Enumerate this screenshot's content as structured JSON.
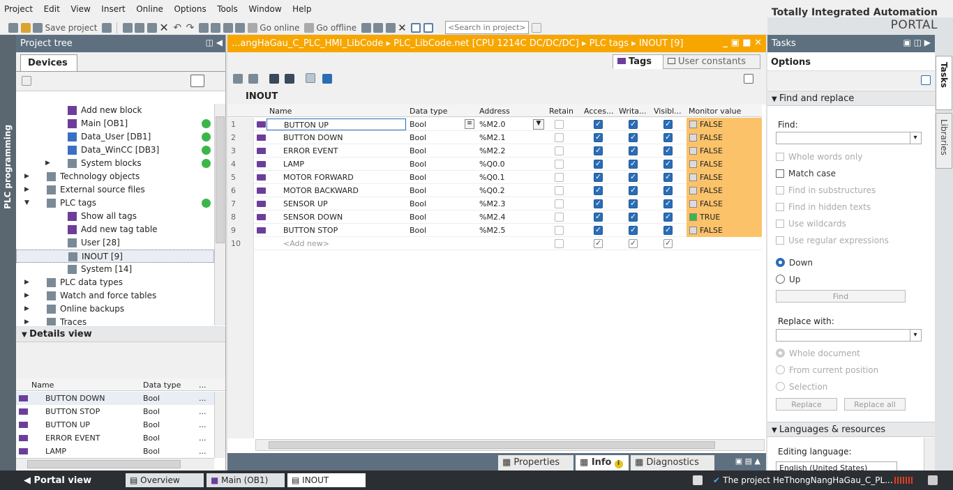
{
  "menu": [
    "Project",
    "Edit",
    "View",
    "Insert",
    "Online",
    "Options",
    "Tools",
    "Window",
    "Help"
  ],
  "toolbar": {
    "save": "Save project",
    "go_online": "Go online",
    "go_offline": "Go offline",
    "search_placeholder": "<Search in project>"
  },
  "brand": {
    "line1": "Totally Integrated Automation",
    "line2": "PORTAL"
  },
  "side_tab": "PLC programming",
  "project_tree": {
    "title": "Project tree",
    "devices_tab": "Devices",
    "items": [
      {
        "label": "Add new block",
        "status": false
      },
      {
        "label": "Main [OB1]",
        "status": true
      },
      {
        "label": "Data_User [DB1]",
        "status": true
      },
      {
        "label": "Data_WinCC [DB3]",
        "status": true
      },
      {
        "label": "System blocks",
        "status": true
      },
      {
        "label": "Technology objects",
        "status": false
      },
      {
        "label": "External source files",
        "status": false
      },
      {
        "label": "PLC tags",
        "status": true
      },
      {
        "label": "Show all tags",
        "status": false
      },
      {
        "label": "Add new tag table",
        "status": false
      },
      {
        "label": "User [28]",
        "status": false
      },
      {
        "label": "INOUT [9]",
        "status": false
      },
      {
        "label": "System [14]",
        "status": false
      },
      {
        "label": "PLC data types",
        "status": false
      },
      {
        "label": "Watch and force tables",
        "status": false
      },
      {
        "label": "Online backups",
        "status": false
      },
      {
        "label": "Traces",
        "status": false
      }
    ]
  },
  "details": {
    "title": "Details view",
    "col_name": "Name",
    "col_type": "Data type",
    "col_more": "...",
    "rows": [
      {
        "name": "BUTTON DOWN",
        "type": "Bool"
      },
      {
        "name": "BUTTON STOP",
        "type": "Bool"
      },
      {
        "name": "BUTTON UP",
        "type": "Bool"
      },
      {
        "name": "ERROR EVENT",
        "type": "Bool"
      },
      {
        "name": "LAMP",
        "type": "Bool"
      }
    ]
  },
  "editor": {
    "breadcrumb": [
      "...angHaGau_C_PLC_HMI_LibCode",
      "PLC_LibCode.net [CPU 1214C DC/DC/DC]",
      "PLC tags",
      "INOUT [9]"
    ],
    "tab_tags": "Tags",
    "tab_constants": "User constants",
    "table_title": "INOUT",
    "columns": [
      "Name",
      "Data type",
      "Address",
      "Retain",
      "Acces...",
      "Writa...",
      "Visibl...",
      "Monitor value"
    ],
    "rows": [
      {
        "n": "1",
        "name": "BUTTON UP",
        "type": "Bool",
        "addr": "%M2.0",
        "mon": "FALSE"
      },
      {
        "n": "2",
        "name": "BUTTON DOWN",
        "type": "Bool",
        "addr": "%M2.1",
        "mon": "FALSE"
      },
      {
        "n": "3",
        "name": "ERROR EVENT",
        "type": "Bool",
        "addr": "%M2.2",
        "mon": "FALSE"
      },
      {
        "n": "4",
        "name": "LAMP",
        "type": "Bool",
        "addr": "%Q0.0",
        "mon": "FALSE"
      },
      {
        "n": "5",
        "name": "MOTOR FORWARD",
        "type": "Bool",
        "addr": "%Q0.1",
        "mon": "FALSE"
      },
      {
        "n": "6",
        "name": "MOTOR BACKWARD",
        "type": "Bool",
        "addr": "%Q0.2",
        "mon": "FALSE"
      },
      {
        "n": "7",
        "name": "SENSOR UP",
        "type": "Bool",
        "addr": "%M2.3",
        "mon": "FALSE"
      },
      {
        "n": "8",
        "name": "SENSOR DOWN",
        "type": "Bool",
        "addr": "%M2.4",
        "mon": "TRUE"
      },
      {
        "n": "9",
        "name": "BUTTON STOP",
        "type": "Bool",
        "addr": "%M2.5",
        "mon": "FALSE"
      }
    ],
    "add_row": {
      "n": "10",
      "name": "<Add new>"
    }
  },
  "info_tabs": [
    "Properties",
    "Info",
    "Diagnostics"
  ],
  "tasks": {
    "title": "Tasks",
    "options": "Options",
    "find_replace": "Find and replace",
    "find_label": "Find:",
    "whole_words": "Whole words only",
    "match_case": "Match case",
    "find_sub": "Find in substructures",
    "find_hidden": "Find in hidden texts",
    "wildcards": "Use wildcards",
    "regex": "Use regular expressions",
    "down": "Down",
    "up": "Up",
    "find_btn": "Find",
    "replace_with": "Replace with:",
    "whole_doc": "Whole document",
    "from_current": "From current position",
    "selection": "Selection",
    "replace_btn": "Replace",
    "replace_all_btn": "Replace all",
    "lang_res": "Languages & resources",
    "editing_lang": "Editing language:",
    "lang_value": "English (United States)",
    "side_tasks": "Tasks",
    "side_libraries": "Libraries"
  },
  "bottom": {
    "portal_view": "Portal view",
    "overview": "Overview",
    "main_ob1": "Main (OB1)",
    "inout": "INOUT",
    "status": "The project HeThongNangHaGau_C_PL..."
  }
}
